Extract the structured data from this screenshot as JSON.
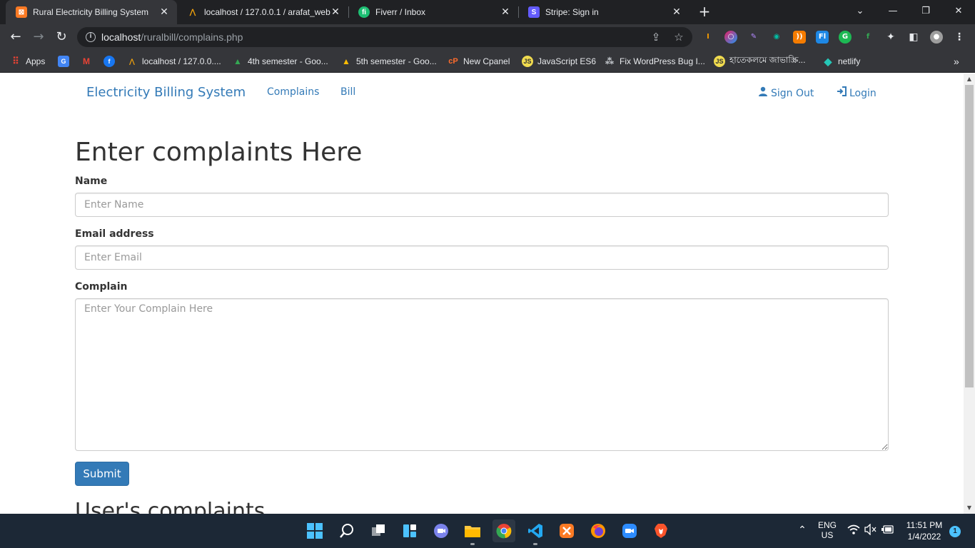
{
  "browser": {
    "tabs": [
      {
        "title": "Rural Electricity Billing System",
        "favicon": "xampp-icon",
        "color": "#fb7a24",
        "active": true
      },
      {
        "title": "localhost / 127.0.0.1 / arafat_web",
        "favicon": "phpmyadmin-icon",
        "color": "#f2a20c",
        "active": false
      },
      {
        "title": "Fiverr / Inbox",
        "favicon": "fiverr-icon",
        "color": "#1dbf73",
        "active": false
      },
      {
        "title": "Stripe: Sign in",
        "favicon": "stripe-icon",
        "color": "#635bff",
        "active": false
      }
    ],
    "url_host": "localhost",
    "url_path": "/ruralbill/complains.php",
    "bookmarks": [
      {
        "label": "Apps",
        "icon": "apps-grid-icon"
      },
      {
        "label": "",
        "icon": "google-translate-icon"
      },
      {
        "label": "",
        "icon": "gmail-icon"
      },
      {
        "label": "",
        "icon": "facebook-icon"
      },
      {
        "label": "localhost / 127.0.0....",
        "icon": "phpmyadmin-icon"
      },
      {
        "label": "4th semester - Goo...",
        "icon": "google-drive-icon"
      },
      {
        "label": "5th semester - Goo...",
        "icon": "google-drive-icon"
      },
      {
        "label": "New Cpanel",
        "icon": "cpanel-icon"
      },
      {
        "label": "JavaScript ES6",
        "icon": "js-icon"
      },
      {
        "label": "Fix WordPress Bug I...",
        "icon": "network-icon"
      },
      {
        "label": "হাতেকলমে জাভাস্ক্রি...",
        "icon": "js-icon"
      },
      {
        "label": "netlify",
        "icon": "netlify-icon"
      }
    ]
  },
  "navbar": {
    "brand": "Electricity Billing System",
    "links": [
      "Complains",
      "Bill"
    ],
    "sign_out": "Sign Out",
    "login": "Login"
  },
  "form": {
    "heading": "Enter complaints Here",
    "name_label": "Name",
    "name_placeholder": "Enter Name",
    "email_label": "Email address",
    "email_placeholder": "Enter Email",
    "complain_label": "Complain",
    "complain_placeholder": "Enter Your Complain Here",
    "submit_label": "Submit"
  },
  "user_complaints_heading": "User's complaints",
  "taskbar": {
    "lang_top": "ENG",
    "lang_bottom": "US",
    "time": "11:51 PM",
    "date": "1/4/2022",
    "notifications": "1"
  }
}
